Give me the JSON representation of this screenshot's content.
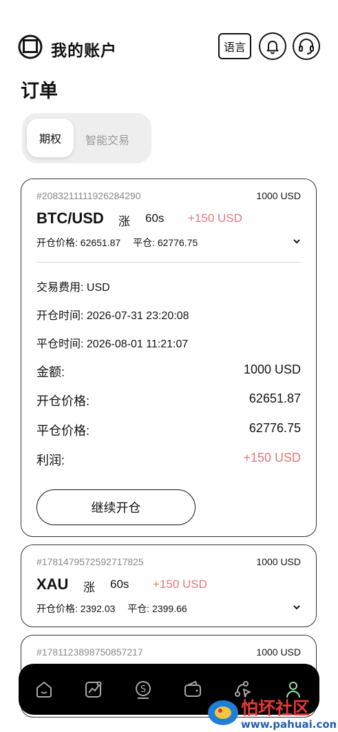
{
  "header": {
    "title": "我的账户",
    "language_label": "语言",
    "icons": [
      "logo-icon",
      "bell-icon",
      "headset-icon"
    ]
  },
  "page": {
    "title": "订单"
  },
  "tabs": [
    {
      "label": "期权",
      "active": true
    },
    {
      "label": "智能交易",
      "active": false
    }
  ],
  "orders": [
    {
      "id": "#2083211111926284290",
      "amount_label": "1000 USD",
      "pair": "BTC/USD",
      "direction": "涨",
      "period": "60s",
      "profit": "+150 USD",
      "open_price_line": "开仓价格: 62651.87",
      "close_price_line": "平仓: 62776.75",
      "expanded": true,
      "details": {
        "fee": "交易费用: USD",
        "open_time": "开仓时间: 2026-07-31 23:20:08",
        "close_time": "平仓时间: 2026-08-01 11:21:07",
        "amount_key": "金额:",
        "amount_val": "1000 USD",
        "open_price_key": "开仓价格:",
        "open_price_val": "62651.87",
        "close_price_key": "平仓价格:",
        "close_price_val": "62776.75",
        "profit_key": "利润:",
        "profit_val": "+150 USD"
      },
      "continue_label": "继续开仓"
    },
    {
      "id": "#1781479572592717825",
      "amount_label": "1000 USD",
      "pair": "XAU",
      "direction": "涨",
      "period": "60s",
      "profit": "+150 USD",
      "open_price_line": "开仓价格: 2392.03",
      "close_price_line": "平仓: 2399.66",
      "expanded": false
    },
    {
      "id": "#1781123898750857217",
      "amount_label": "1000 USD"
    }
  ],
  "bottom_nav": [
    "home-icon",
    "chart-icon",
    "dollar-icon",
    "wallet-icon",
    "trade-icon",
    "profile-icon"
  ],
  "watermark": {
    "main": "怕坏社区",
    "url": "www.pahuai.com"
  },
  "colors": {
    "profit": "#e07878",
    "nav_bg": "#000000",
    "active_nav": "#9be39b"
  }
}
